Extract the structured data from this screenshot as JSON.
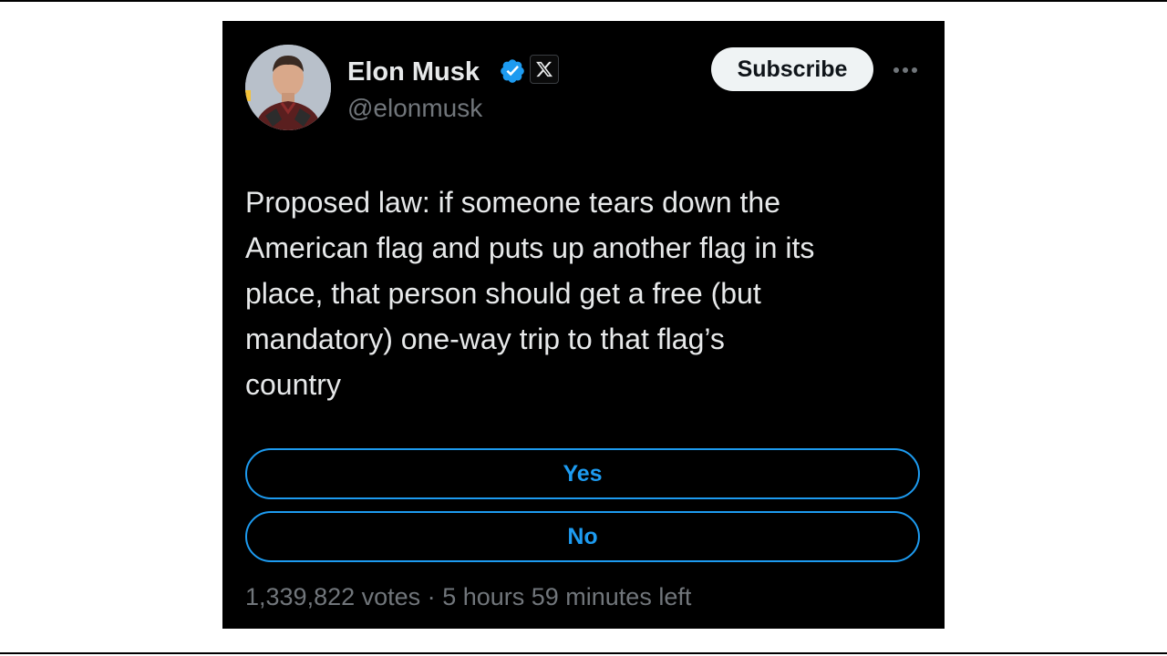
{
  "tweet": {
    "author": {
      "name": "Elon Musk",
      "handle": "@elonmusk",
      "verified": true,
      "affiliation_icon": "x-logo-icon",
      "avatar": "profile-photo"
    },
    "subscribe_label": "Subscribe",
    "more_icon": "more-horizontal-icon",
    "text": "Proposed law: if someone tears down the\nAmerican flag and puts up another flag in its\nplace, that person should get a free (but\nmandatory) one-way trip to that flag’s\ncountry",
    "poll": {
      "options": [
        {
          "label": "Yes"
        },
        {
          "label": "No"
        }
      ],
      "votes": "1,339,822 votes",
      "separator": "·",
      "time_left": "5 hours 59 minutes left"
    }
  },
  "colors": {
    "background": "#000000",
    "text_primary": "#e7e9ea",
    "text_secondary": "#71767b",
    "accent_blue": "#1d9bf0",
    "subscribe_bg": "#eff3f4"
  }
}
